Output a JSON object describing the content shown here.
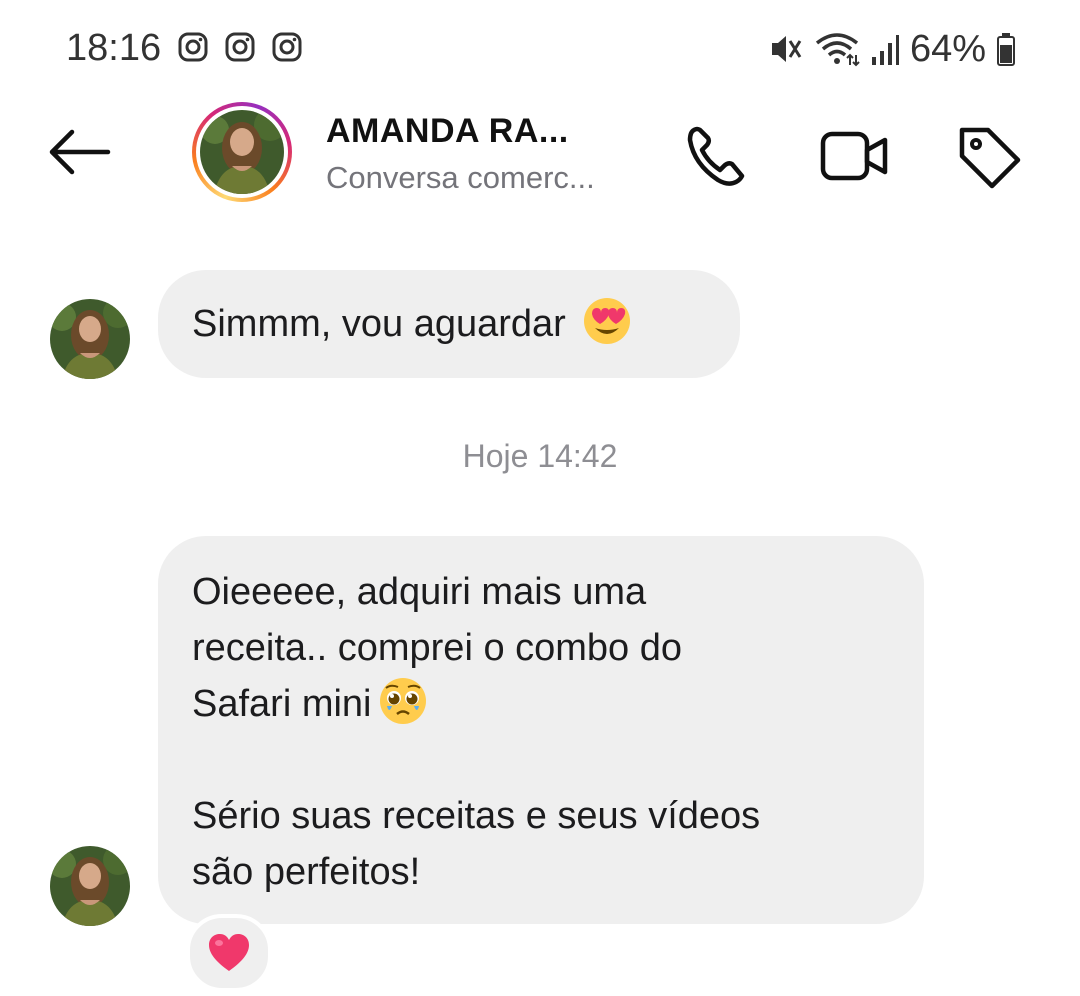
{
  "status_bar": {
    "time": "18:16",
    "notification_icons": [
      "instagram-icon",
      "instagram-icon",
      "instagram-icon"
    ],
    "battery": "64%"
  },
  "header": {
    "contact_name": "AMANDA RA...",
    "subtitle": "Conversa comerc..."
  },
  "messages": [
    {
      "text": "Simmm, vou aguardar",
      "emoji": "heart-eyes"
    },
    {
      "timestamp": "Hoje 14:42"
    },
    {
      "lines": [
        "Oieeeee, adquiri mais uma",
        "receita.. comprei o combo do",
        "Safari mini"
      ],
      "emoji": "pleading-face",
      "lines2": [
        "Sério suas receitas e seus vídeos",
        "são perfeitos!"
      ],
      "reaction": "heart"
    }
  ],
  "colors": {
    "bubble": "#efefef",
    "reaction_heart": "#f0386b",
    "timestamp": "#8e8e93"
  }
}
